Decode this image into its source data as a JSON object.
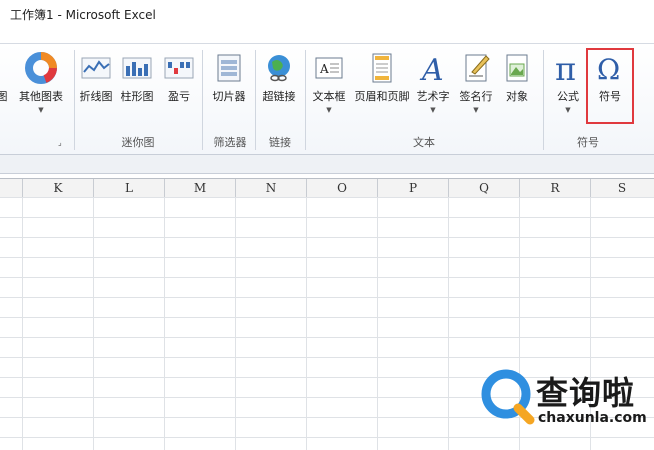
{
  "window": {
    "title": "工作簿1 - Microsoft Excel"
  },
  "ribbon": {
    "buttons": [
      {
        "id": "chart-partial",
        "label": "图"
      },
      {
        "id": "other-charts",
        "label": "其他图表",
        "has_dropdown": true
      },
      {
        "id": "sparkline-line",
        "label": "折线图"
      },
      {
        "id": "sparkline-column",
        "label": "柱形图"
      },
      {
        "id": "sparkline-winloss",
        "label": "盈亏"
      },
      {
        "id": "slicer",
        "label": "切片器"
      },
      {
        "id": "hyperlink",
        "label": "超链接"
      },
      {
        "id": "textbox",
        "label": "文本框",
        "has_dropdown": true
      },
      {
        "id": "header-footer",
        "label": "页眉和页脚"
      },
      {
        "id": "wordart",
        "label": "艺术字",
        "has_dropdown": true
      },
      {
        "id": "signature-line",
        "label": "签名行",
        "has_dropdown": true
      },
      {
        "id": "object",
        "label": "对象"
      },
      {
        "id": "equation",
        "label": "公式",
        "has_dropdown": true
      },
      {
        "id": "symbol",
        "label": "符号"
      }
    ],
    "groups": [
      {
        "label": "迷你图"
      },
      {
        "label": "筛选器"
      },
      {
        "label": "链接"
      },
      {
        "label": "文本"
      },
      {
        "label": "符号"
      }
    ]
  },
  "sheet": {
    "columns": [
      "K",
      "L",
      "M",
      "N",
      "O",
      "P",
      "Q",
      "R",
      "S"
    ]
  },
  "watermark": {
    "text": "查询啦",
    "url": "chaxunla.com"
  },
  "colors": {
    "highlight": "#e0393e",
    "grid": "#dfe2e6"
  }
}
